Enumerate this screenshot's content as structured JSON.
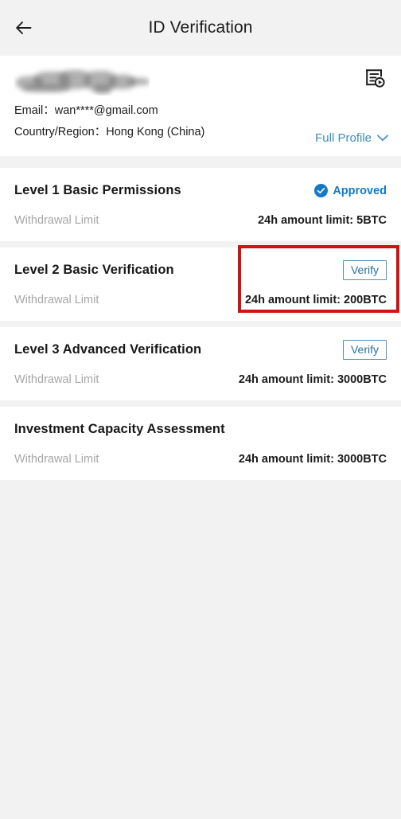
{
  "appbar": {
    "back_icon": "arrow-left-icon",
    "title": "ID Verification"
  },
  "profile": {
    "name_redacted": "",
    "email_label": "Email：",
    "email_value": "wan****@gmail.com",
    "country_label": "Country/Region：",
    "country_value": "Hong Kong (China)",
    "full_profile_label": "Full Profile",
    "full_profile_chevron": "chevron-down-icon",
    "record_icon": "verification-record-icon"
  },
  "levels": [
    {
      "title": "Level 1 Basic Permissions",
      "status_label": "Approved",
      "status_icon": "check-circle-icon",
      "action": null,
      "withdrawal_label": "Withdrawal Limit",
      "limit": "24h amount limit: 5BTC",
      "highlighted": false
    },
    {
      "title": "Level 2 Basic Verification",
      "status_label": null,
      "status_icon": null,
      "action": "Verify",
      "withdrawal_label": "Withdrawal Limit",
      "limit": "24h amount limit: 200BTC",
      "highlighted": true
    },
    {
      "title": "Level 3 Advanced Verification",
      "status_label": null,
      "status_icon": null,
      "action": "Verify",
      "withdrawal_label": "Withdrawal Limit",
      "limit": "24h amount limit: 3000BTC",
      "highlighted": false
    },
    {
      "title": "Investment Capacity Assessment",
      "status_label": null,
      "status_icon": null,
      "action": null,
      "withdrawal_label": "Withdrawal Limit",
      "limit": "24h amount limit: 3000BTC",
      "highlighted": false
    }
  ],
  "colors": {
    "page_background": "#f2f2f2",
    "card_background": "#ffffff",
    "primary_text": "#1b1b1b",
    "muted_text": "#a6a6a6",
    "link_blue": "#3d8bbf",
    "approved_blue": "#1479c9",
    "verify_border": "#4f90b5",
    "annotation_red": "#cc1414"
  }
}
